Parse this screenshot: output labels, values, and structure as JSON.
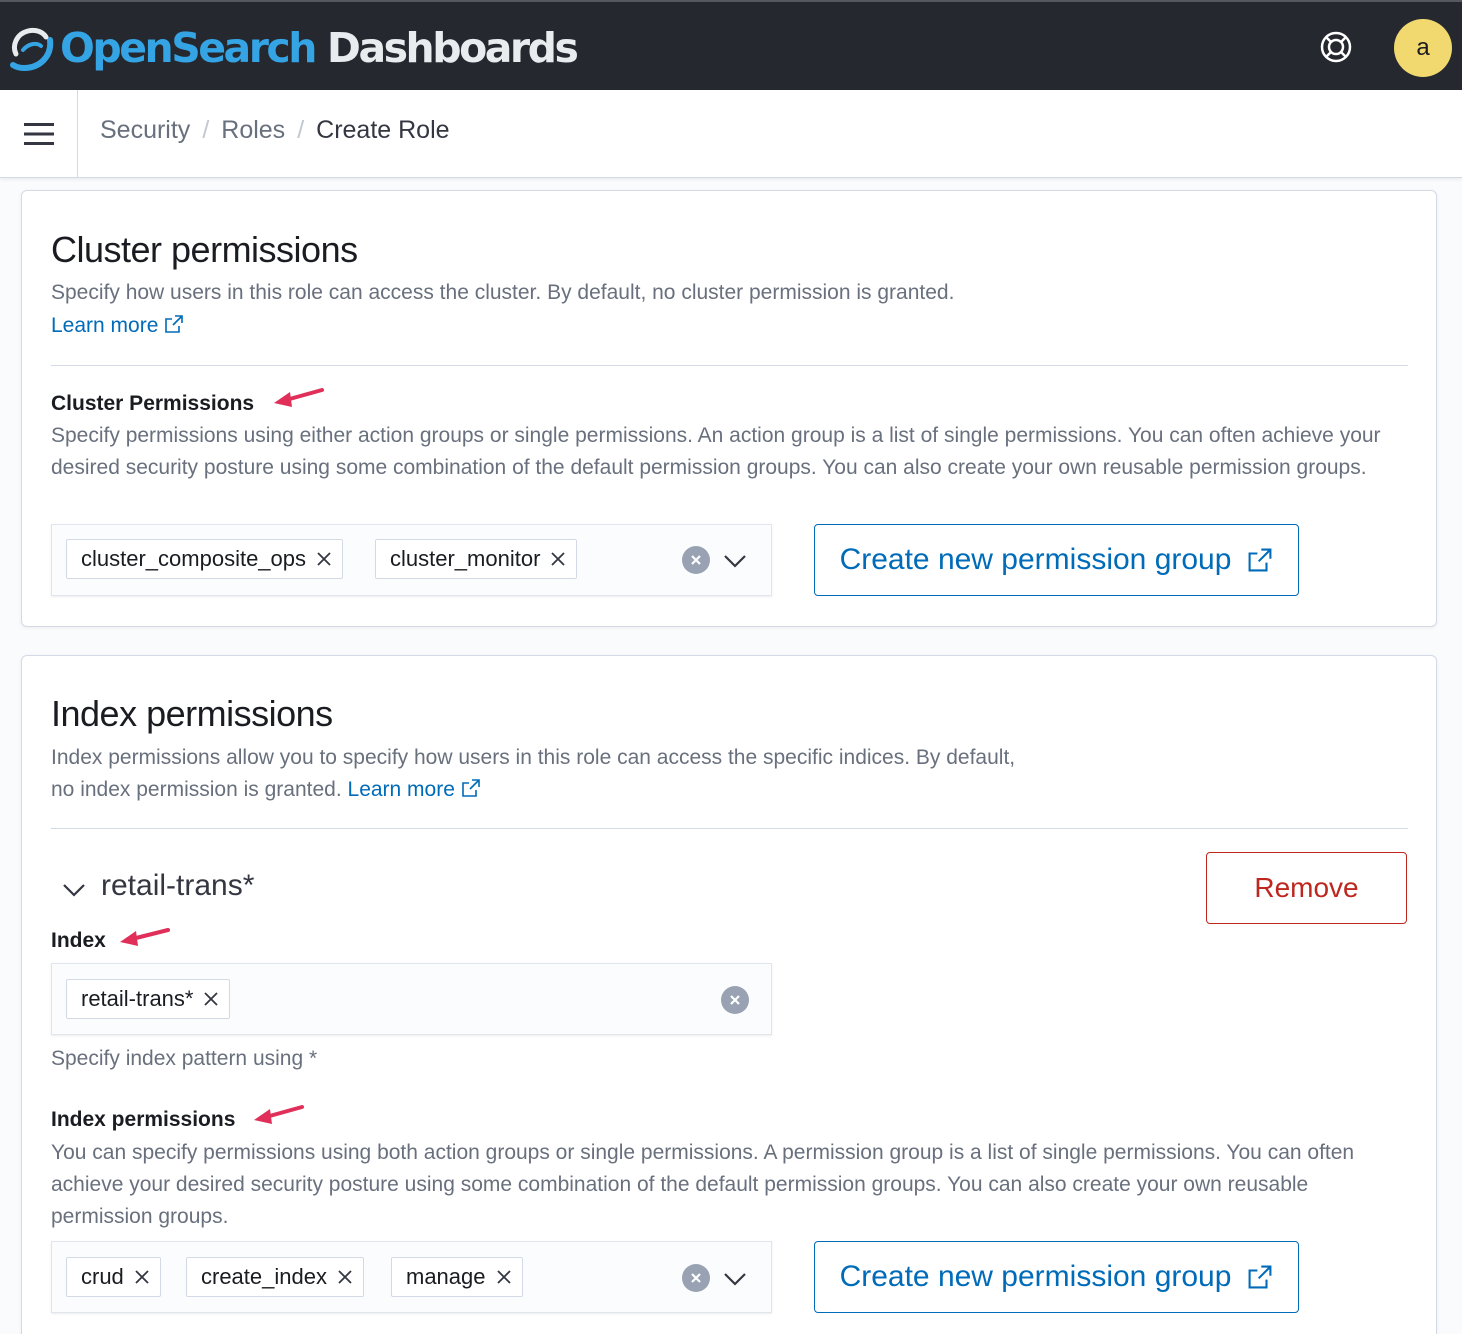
{
  "header": {
    "logo_open": "OpenSearch",
    "logo_dashboards": "Dashboards",
    "avatar_initial": "a"
  },
  "breadcrumbs": {
    "items": [
      "Security",
      "Roles",
      "Create Role"
    ],
    "separator": "/"
  },
  "cluster": {
    "title": "Cluster permissions",
    "description": "Specify how users in this role can access the cluster. By default, no cluster permission is granted.",
    "learn_more": "Learn more",
    "field_label": "Cluster Permissions",
    "field_help": "Specify permissions using either action groups or single permissions. An action group is a list of single permissions. You can often achieve your desired security posture using some combination of the default permission groups. You can also create your own reusable permission groups.",
    "selected": [
      "cluster_composite_ops",
      "cluster_monitor"
    ],
    "create_group_button": "Create new permission group"
  },
  "index": {
    "title": "Index permissions",
    "description": "Index permissions allow you to specify how users in this role can access the specific indices. By default, no index permission is granted.",
    "learn_more": "Learn more",
    "entry_title": "retail-trans*",
    "remove_button": "Remove",
    "index_label": "Index",
    "index_selected": [
      "retail-trans*"
    ],
    "index_help": "Specify index pattern using *",
    "perm_label": "Index permissions",
    "perm_help": "You can specify permissions using both action groups or single permissions. A permission group is a list of single permissions. You can often achieve your desired security posture using some combination of the default permission groups. You can also create your own reusable permission groups.",
    "perm_selected": [
      "crud",
      "create_index",
      "manage"
    ],
    "create_group_button": "Create new permission group"
  },
  "colors": {
    "header_bg": "#25282f",
    "link": "#006bb8",
    "danger": "#bd271e",
    "annotation_arrow": "#e0305a",
    "avatar": "#f1d86f",
    "logo_accent": "#34a4e4"
  }
}
